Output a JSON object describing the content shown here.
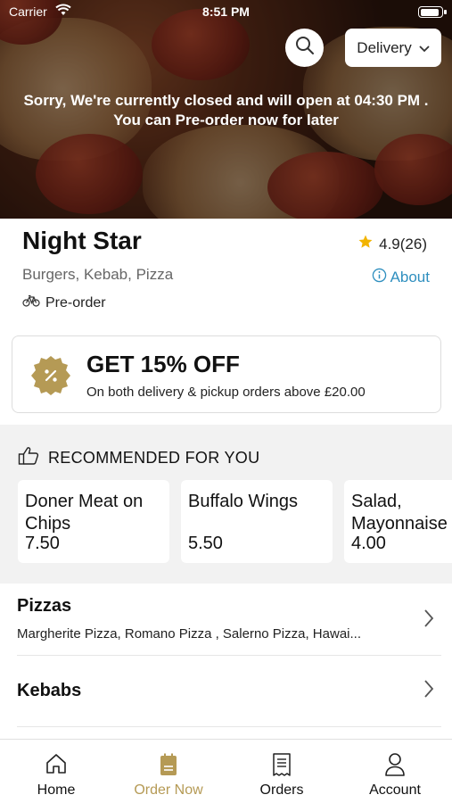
{
  "status_bar": {
    "carrier": "Carrier",
    "time": "8:51 PM",
    "battery_level": 0.9
  },
  "hero": {
    "delivery_mode": "Delivery",
    "closed_line1": "Sorry, We're currently closed and will open at 04:30 PM .",
    "closed_line2": "You can Pre-order now for later"
  },
  "restaurant": {
    "name": "Night Star",
    "rating": "4.9(26)",
    "cuisines": "Burgers, Kebab, Pizza",
    "about": "About",
    "preorder": "Pre-order"
  },
  "offer": {
    "title": "GET 15% OFF",
    "subtitle": "On both delivery & pickup orders above £20.00"
  },
  "recommended": {
    "heading": "RECOMMENDED FOR YOU",
    "items": [
      {
        "name": "Doner Meat on Chips",
        "price": "7.50"
      },
      {
        "name": "Buffalo Wings",
        "price": "5.50"
      },
      {
        "name": "Salad, Mayonnaise",
        "price": "4.00"
      }
    ]
  },
  "categories": [
    {
      "title": "Pizzas",
      "items": "Margherite Pizza, Romano Pizza , Salerno Pizza, Hawai..."
    },
    {
      "title": "Kebabs",
      "items": ""
    }
  ],
  "tabbar": {
    "home": "Home",
    "order_now": "Order Now",
    "orders": "Orders",
    "account": "Account"
  },
  "colors": {
    "accent_gold": "#b59a55",
    "link_blue": "#2f8fbf",
    "star": "#f2b400"
  }
}
